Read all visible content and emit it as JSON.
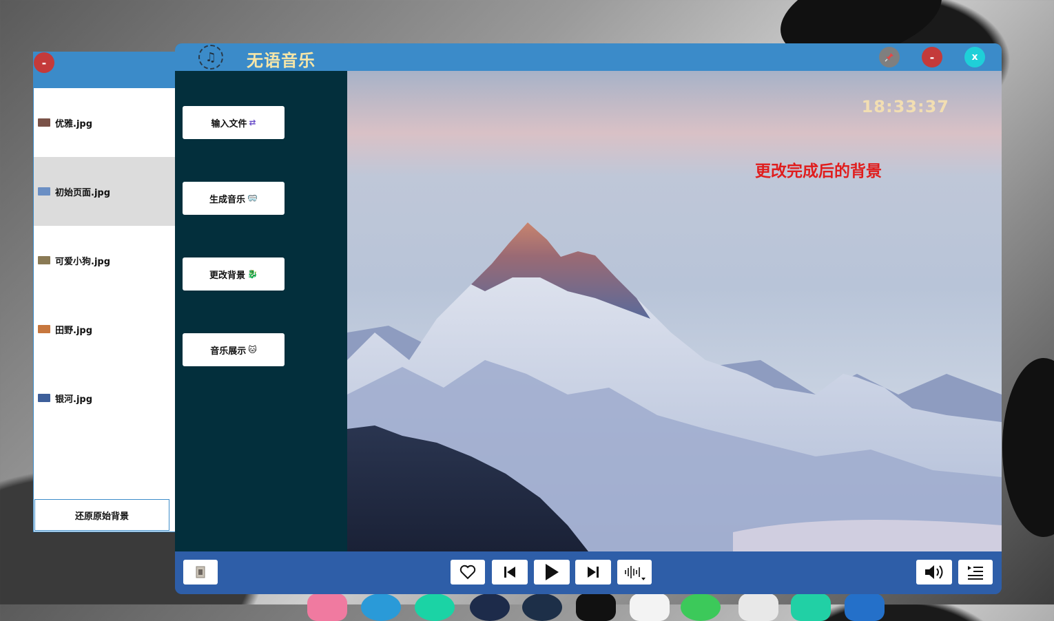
{
  "side_panel": {
    "items": [
      {
        "label": "优雅.jpg",
        "thumb": "#7a5248"
      },
      {
        "label": "初始页面.jpg",
        "thumb": "#6b8fc4"
      },
      {
        "label": "可爱小狗.jpg",
        "thumb": "#8a7a55"
      },
      {
        "label": "田野.jpg",
        "thumb": "#c7773e"
      },
      {
        "label": "银河.jpg",
        "thumb": "#3d5f9a"
      }
    ],
    "selected_index": 1,
    "restore_label": "还原原始背景",
    "close_label": "-"
  },
  "main": {
    "app_title": "无语音乐",
    "titlebar": {
      "pin_icon": "pin-icon",
      "minimize_label": "-",
      "close_label": "x"
    },
    "menu": [
      {
        "label": "输入文件",
        "emoji": "⇄"
      },
      {
        "label": "生成音乐",
        "emoji": "🥽"
      },
      {
        "label": "更改背景",
        "emoji": "🐉"
      },
      {
        "label": "音乐展示",
        "emoji": "🐱"
      }
    ],
    "clock": "18:33:37",
    "caption": "更改完成后的背景"
  },
  "controls": [
    "cover-icon",
    "heart-icon",
    "previous-icon",
    "play-icon",
    "next-icon",
    "equalizer-icon",
    "volume-icon",
    "playlist-icon"
  ],
  "colors": {
    "titlebar": "#3b8bc9",
    "sidebar": "#032f3c",
    "bottom_bar": "#2e5ea8",
    "close_red": "#c43a3a",
    "close_cyan": "#1fcfd8",
    "pin_gray": "#7f7f7f",
    "caption_red": "#e01d1d",
    "title_yellow": "#f6e6a8"
  }
}
